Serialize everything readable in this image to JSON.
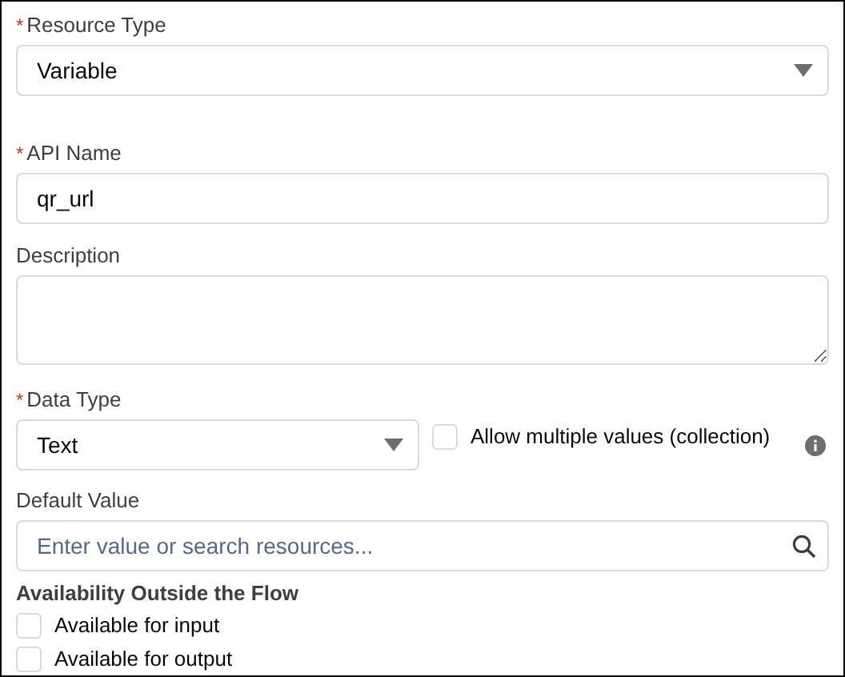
{
  "required_mark": "*",
  "resource_type": {
    "label": "Resource Type",
    "required": true,
    "value": "Variable"
  },
  "api_name": {
    "label": "API Name",
    "required": true,
    "value": "qr_url"
  },
  "description": {
    "label": "Description",
    "required": false
  },
  "data_type": {
    "label": "Data Type",
    "required": true,
    "value": "Text",
    "collection": {
      "label": "Allow multiple values (collection)",
      "checked": false
    }
  },
  "default_value": {
    "label": "Default Value",
    "required": false,
    "placeholder": "Enter value or search resources..."
  },
  "availability": {
    "heading": "Availability Outside the Flow",
    "options": [
      {
        "label": "Available for input",
        "checked": false
      },
      {
        "label": "Available for output",
        "checked": false
      }
    ]
  }
}
